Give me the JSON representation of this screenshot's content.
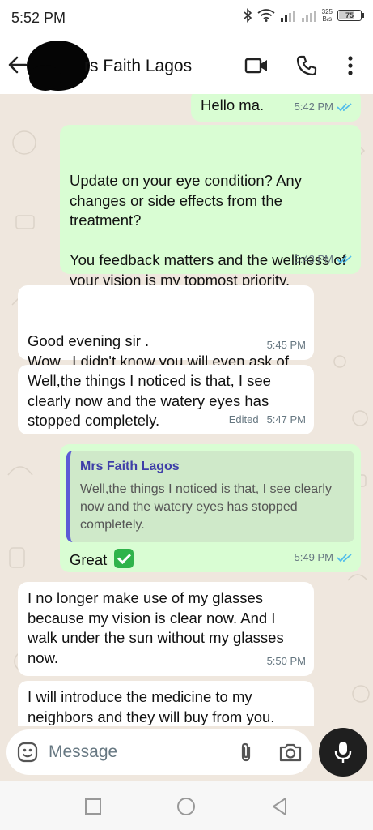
{
  "status_bar": {
    "time": "5:52 PM",
    "net_speed_value": "325",
    "net_speed_unit": "B/s",
    "battery_level": "75",
    "icons": [
      "bluetooth-icon",
      "wifi-icon",
      "signal-icon",
      "signal-icon-2",
      "battery-icon"
    ]
  },
  "header": {
    "contact_name": "rs Faith Lagos",
    "icons": [
      "back-arrow-icon",
      "video-call-icon",
      "phone-icon",
      "more-vert-icon"
    ]
  },
  "messages": [
    {
      "direction": "outgoing",
      "text": "Hello ma.",
      "time": "5:42 PM",
      "read": true
    },
    {
      "direction": "outgoing",
      "text": "Update on your eye condition? Any changes or side effects from the treatment?\n\nYou feedback matters and the wellness of your vision is my topmost priority.",
      "time": "5:43 PM",
      "read": true
    },
    {
      "direction": "incoming",
      "text": "Good evening sir .\nWow...I didn't know you will even ask of my eye health.",
      "time": "5:45 PM"
    },
    {
      "direction": "incoming",
      "text": "Well,the things I noticed is that, I see clearly now and the watery eyes has stopped completely.",
      "time": "5:47 PM",
      "edited_label": "Edited"
    },
    {
      "direction": "outgoing",
      "quote_author": "Mrs Faith Lagos",
      "quote_text": "Well,the things I noticed is that, I see clearly now and the watery eyes has stopped completely.",
      "text": "Great",
      "emoji": "check-mark-button-emoji",
      "time": "5:49 PM",
      "read": true
    },
    {
      "direction": "incoming",
      "text": "I no longer make use of my glasses because my vision is clear now. And I walk under the sun without my glasses now.",
      "time": "5:50 PM"
    },
    {
      "direction": "incoming",
      "text": "I will introduce the medicine to my neighbors and they will buy from you."
    }
  ],
  "composer": {
    "placeholder": "Message",
    "icons": [
      "emoji-icon",
      "attach-icon",
      "camera-icon",
      "mic-icon"
    ]
  },
  "nav_bar": {
    "icons": [
      "recents-square-icon",
      "home-circle-icon",
      "back-triangle-icon"
    ]
  },
  "colors": {
    "chat_background": "#efe7de",
    "outgoing_bubble": "#d9fdd3",
    "incoming_bubble": "#ffffff",
    "read_tick": "#53bdeb",
    "quote_bar": "#5b5bd6",
    "meta_text": "#667781"
  }
}
